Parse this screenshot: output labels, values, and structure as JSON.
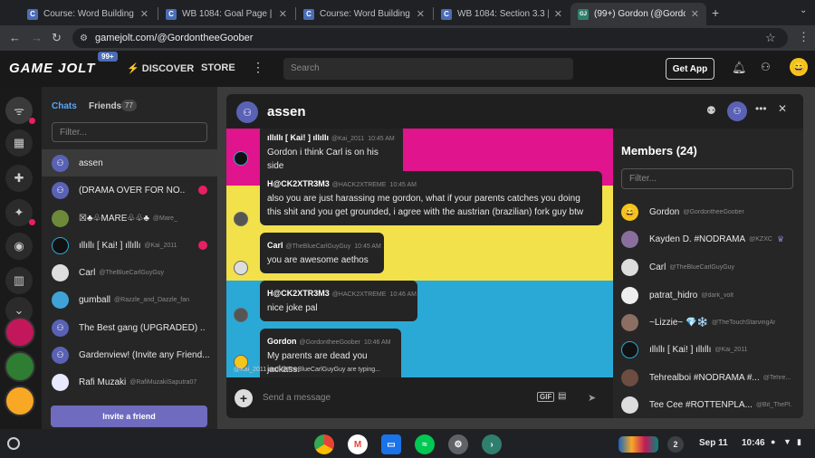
{
  "browser": {
    "tabs": [
      {
        "label": "Course: Word Building 1084",
        "icon": "C"
      },
      {
        "label": "WB 1084: Goal Page | acecon",
        "icon": "C"
      },
      {
        "label": "Course: Word Building 1084",
        "icon": "C"
      },
      {
        "label": "WB 1084: Section 3.3 | acecon",
        "icon": "C"
      },
      {
        "label": "(99+) Gordon (@Gordontheee",
        "icon": "GJ"
      }
    ],
    "url": "gamejolt.com/@GordontheeGoober"
  },
  "gj_header": {
    "logo": "GAME JOLT",
    "logo_badge": "99+",
    "discover": "DISCOVER",
    "store": "STORE",
    "search_placeholder": "Search",
    "get_app": "Get App"
  },
  "chats_panel": {
    "tab_chats": "Chats",
    "tab_friends": "Friends",
    "friends_count": "77",
    "filter_placeholder": "Filter...",
    "items": [
      {
        "name": "assen",
        "handle": "",
        "unread": false
      },
      {
        "name": "(DRAMA OVER FOR NO...",
        "handle": "",
        "unread": true
      },
      {
        "name": "☒♣♧MARE♧♧♣",
        "handle": "@Mare_",
        "unread": false
      },
      {
        "name": "ıllıllı [ Kai! ] ıllıllı",
        "handle": "@Kai_2011",
        "unread": true
      },
      {
        "name": "Carl",
        "handle": "@TheBlueCarlGuyGuy",
        "unread": false
      },
      {
        "name": "gumball",
        "handle": "@Razzle_and_Dazzle_fan",
        "unread": false
      },
      {
        "name": "The Best gang (UPGRADED) ...",
        "handle": "",
        "unread": false
      },
      {
        "name": "Gardenview! (Invite any Friend...",
        "handle": "",
        "unread": false
      },
      {
        "name": "Rafi Muzaki",
        "handle": "@RafiMuzakiSaputra07",
        "unread": false
      }
    ],
    "invite_label": "Invite a friend"
  },
  "chat": {
    "title": "assen",
    "messages": [
      {
        "author": "ıllıllı [ Kai! ] ıllıllı",
        "handle": "@Kai_2011",
        "time": "10:45 AM",
        "text": "Gordon i think Carl is on his side"
      },
      {
        "author": "H@CK2XTR3M3",
        "handle": "@HACK2XTREME",
        "time": "10:45 AM",
        "text": "also you are just harassing me gordon, what if your parents catches you doing this shit and you get grounded, i agree with the austrian (brazilian) fork guy btw"
      },
      {
        "author": "Carl",
        "handle": "@TheBlueCarlGuyGuy",
        "time": "10:45 AM",
        "text": "you are awesome aethos"
      },
      {
        "author": "H@CK2XTR3M3",
        "handle": "@HACK2XTREME",
        "time": "10:46 AM",
        "text": "nice joke pal"
      },
      {
        "author": "Gordon",
        "handle": "@GordontheeGoober",
        "time": "10:46 AM",
        "text": "My parents are dead you jackass."
      }
    ],
    "typing": "@Kai_2011 and @TheBlueCarlGuyGuy are typing...",
    "input_placeholder": "Send a message",
    "gif_label": "GIF"
  },
  "members": {
    "title": "Members (24)",
    "filter_placeholder": "Filter...",
    "items": [
      {
        "name": "Gordon",
        "handle": "@GordontheeGoober",
        "owner": false
      },
      {
        "name": "Kayden D. #NODRAMA",
        "handle": "@KZXC",
        "owner": true
      },
      {
        "name": "Carl",
        "handle": "@TheBlueCarlGuyGuy",
        "owner": false
      },
      {
        "name": "patrat_hidro",
        "handle": "@dark_volt",
        "owner": false
      },
      {
        "name": "~Lizzie~ 💎❄️",
        "handle": "@TheTouchStarvingAr...",
        "owner": false
      },
      {
        "name": "ıllıllı [ Kai! ] ıllıllı",
        "handle": "@Kai_2011",
        "owner": false
      },
      {
        "name": "Tehrealboi #NODRAMA #...",
        "handle": "@Tehre...",
        "owner": false
      },
      {
        "name": "Tee Cee #ROTTENPLA...",
        "handle": "@Bit_ThePl...",
        "owner": false
      }
    ]
  },
  "taskbar": {
    "notifications": "2",
    "date": "Sep 11",
    "time": "10:46"
  },
  "colors": {
    "band_magenta": "#e0148c",
    "band_yellow": "#f2e14b",
    "band_cyan": "#2aa9d6",
    "accent_blue": "#59a7f5",
    "unread_pink": "#e91e63",
    "invite_purple": "#6f6bbf"
  }
}
